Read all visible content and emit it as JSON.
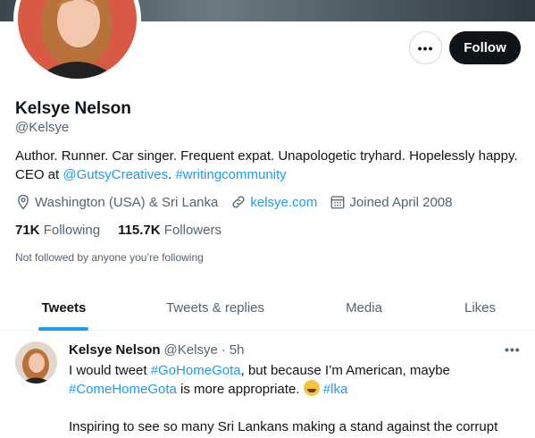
{
  "profile": {
    "name": "Kelsye Nelson",
    "handle": "@Kelsye",
    "bio_text": "Author. Runner. Car singer. Frequent expat. Unapologetic tryhard. Hopelessly happy. CEO at ",
    "bio_link1": "@GutsyCreatives",
    "bio_sep": ". ",
    "bio_link2": "#writingcommunity",
    "location": "Washington (USA) & Sri Lanka",
    "website": "kelsye.com",
    "joined": "Joined April 2008",
    "following_count": "71K",
    "following_label": "Following",
    "followers_count": "115.7K",
    "followers_label": "Followers",
    "not_followed": "Not followed by anyone you’re following"
  },
  "actions": {
    "more_label": "•••",
    "follow_label": "Follow"
  },
  "tabs": [
    {
      "label": "Tweets",
      "active": true
    },
    {
      "label": "Tweets & replies",
      "active": false
    },
    {
      "label": "Media",
      "active": false
    },
    {
      "label": "Likes",
      "active": false
    }
  ],
  "tweet": {
    "author": "Kelsye Nelson",
    "handle": "@Kelsye",
    "separator": "·",
    "time": "5h",
    "more_label": "•••",
    "line1_text": "I would tweet ",
    "line1_link": "#GoHomeGota",
    "line1_rest": ", but because I’m American, maybe",
    "line2_link": "#ComeHomeGota",
    "line2_rest": " is more appropriate. ",
    "line2_emoji": "rofl-emoji",
    "line2_tag": "#lka",
    "para2": "Inspiring to see so many Sri Lankans making a stand against the corrupt"
  },
  "colors": {
    "accent": "#1d9bf0",
    "text": "#0f1419",
    "secondary": "#536471",
    "follow_bg": "#0f1419"
  }
}
